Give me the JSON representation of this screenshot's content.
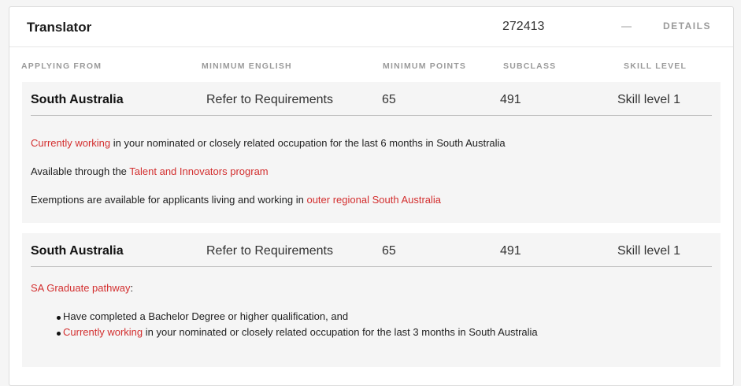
{
  "header": {
    "title": "Translator",
    "code": "272413",
    "details_label": "DETAILS"
  },
  "columns": [
    "APPLYING FROM",
    "MINIMUM ENGLISH",
    "MINIMUM POINTS",
    "SUBCLASS",
    "SKILL LEVEL"
  ],
  "rows": [
    {
      "applying_from": "South Australia",
      "min_english": "Refer to Requirements",
      "min_points": "65",
      "subclass": "491",
      "skill_level": "Skill level 1",
      "notes": [
        {
          "link": "Currently working",
          "text": " in your nominated or closely related occupation for the last 6 months in South Australia"
        },
        {
          "text": "Available through the ",
          "link": "Talent and Innovators program"
        },
        {
          "text": "Exemptions are available for applicants living and working in ",
          "link": "outer regional South Australia"
        }
      ]
    },
    {
      "applying_from": "South Australia",
      "min_english": "Refer to Requirements",
      "min_points": "65",
      "subclass": "491",
      "skill_level": "Skill level 1",
      "pathway_link": "SA Graduate pathway",
      "pathway_colon": ":",
      "bullets": [
        {
          "text": "Have completed a Bachelor Degree or higher qualification, and"
        },
        {
          "link": "Currently working",
          "text": " in your nominated or closely related occupation for the last 3 months in South Australia"
        }
      ]
    }
  ]
}
